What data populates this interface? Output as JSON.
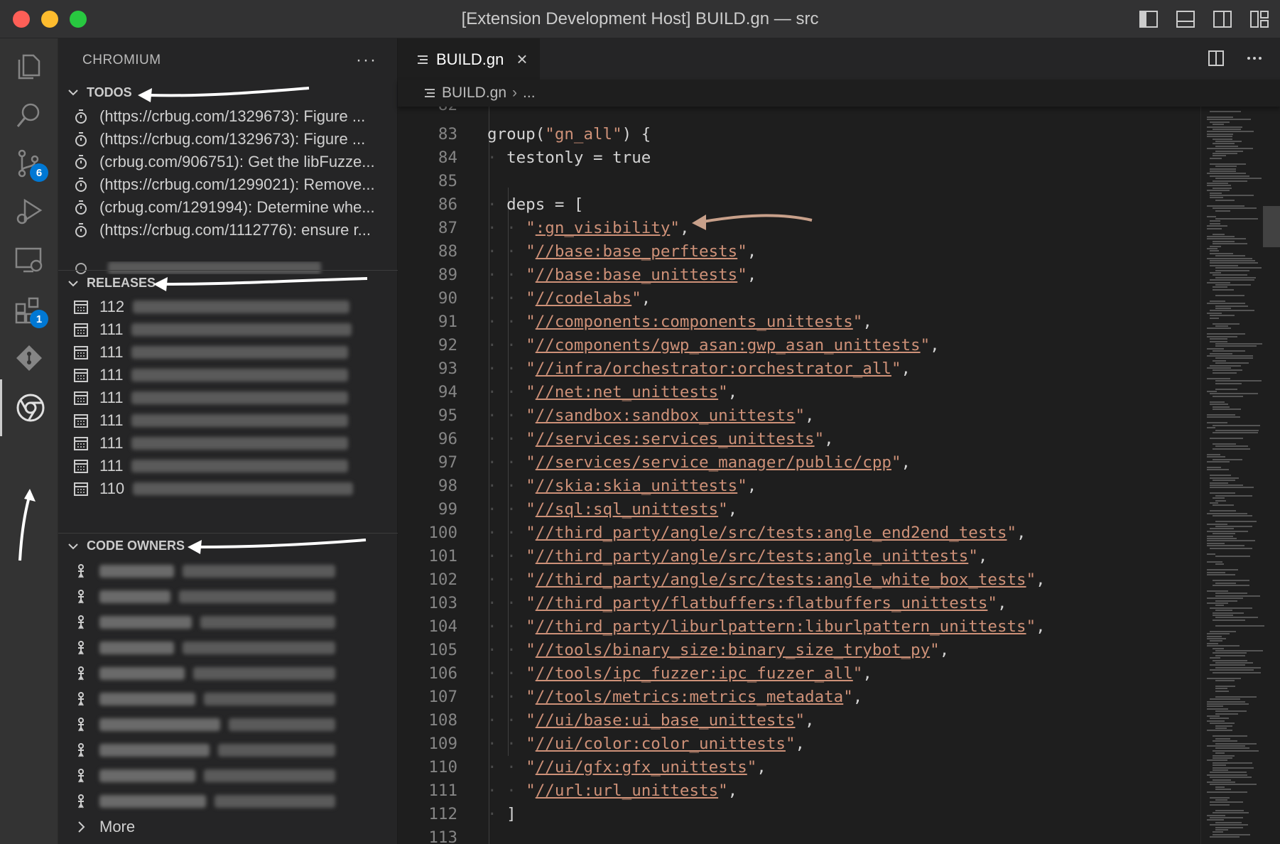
{
  "window": {
    "title": "[Extension Development Host] BUILD.gn — src"
  },
  "activity_bar": {
    "scm_badge": "6",
    "extensions_badge": "1"
  },
  "sidebar": {
    "title": "CHROMIUM",
    "more": "···",
    "todos": {
      "label": "TODOS",
      "items": [
        "(https://crbug.com/1329673): Figure ...",
        "(https://crbug.com/1329673): Figure ...",
        "(crbug.com/906751): Get the libFuzze...",
        "(https://crbug.com/1299021): Remove...",
        "(crbug.com/1291994): Determine whe...",
        "(https://crbug.com/1112776): ensure r..."
      ]
    },
    "releases": {
      "label": "RELEASES",
      "items": [
        "112",
        "111",
        "111",
        "111",
        "111",
        "111",
        "111",
        "111",
        "110"
      ]
    },
    "code_owners": {
      "label": "CODE OWNERS",
      "count": 10,
      "more_label": "More"
    }
  },
  "editor": {
    "tab_label": "BUILD.gn",
    "breadcrumb_file": "BUILD.gn",
    "breadcrumb_rest": "...",
    "lines": [
      {
        "n": "83",
        "kind": "plain",
        "indent": 0,
        "text": "group(",
        "str": "\"gn_all\"",
        "tail": ") {"
      },
      {
        "n": "84",
        "kind": "kw",
        "indent": 1,
        "text": "testonly = true"
      },
      {
        "n": "85",
        "kind": "blank",
        "indent": 0,
        "text": ""
      },
      {
        "n": "86",
        "kind": "kw",
        "indent": 1,
        "text": "deps = ["
      },
      {
        "n": "87",
        "kind": "dep",
        "indent": 2,
        "value": ":gn_visibility"
      },
      {
        "n": "88",
        "kind": "dep",
        "indent": 2,
        "value": "//base:base_perftests"
      },
      {
        "n": "89",
        "kind": "dep",
        "indent": 2,
        "value": "//base:base_unittests"
      },
      {
        "n": "90",
        "kind": "dep",
        "indent": 2,
        "value": "//codelabs"
      },
      {
        "n": "91",
        "kind": "dep",
        "indent": 2,
        "value": "//components:components_unittests"
      },
      {
        "n": "92",
        "kind": "dep",
        "indent": 2,
        "value": "//components/gwp_asan:gwp_asan_unittests"
      },
      {
        "n": "93",
        "kind": "dep",
        "indent": 2,
        "value": "//infra/orchestrator:orchestrator_all"
      },
      {
        "n": "94",
        "kind": "dep",
        "indent": 2,
        "value": "//net:net_unittests"
      },
      {
        "n": "95",
        "kind": "dep",
        "indent": 2,
        "value": "//sandbox:sandbox_unittests"
      },
      {
        "n": "96",
        "kind": "dep",
        "indent": 2,
        "value": "//services:services_unittests"
      },
      {
        "n": "97",
        "kind": "dep",
        "indent": 2,
        "value": "//services/service_manager/public/cpp"
      },
      {
        "n": "98",
        "kind": "dep",
        "indent": 2,
        "value": "//skia:skia_unittests"
      },
      {
        "n": "99",
        "kind": "dep",
        "indent": 2,
        "value": "//sql:sql_unittests"
      },
      {
        "n": "100",
        "kind": "dep",
        "indent": 2,
        "value": "//third_party/angle/src/tests:angle_end2end_tests"
      },
      {
        "n": "101",
        "kind": "dep",
        "indent": 2,
        "value": "//third_party/angle/src/tests:angle_unittests"
      },
      {
        "n": "102",
        "kind": "dep",
        "indent": 2,
        "value": "//third_party/angle/src/tests:angle_white_box_tests"
      },
      {
        "n": "103",
        "kind": "dep",
        "indent": 2,
        "value": "//third_party/flatbuffers:flatbuffers_unittests"
      },
      {
        "n": "104",
        "kind": "dep",
        "indent": 2,
        "value": "//third_party/liburlpattern:liburlpattern_unittests"
      },
      {
        "n": "105",
        "kind": "dep",
        "indent": 2,
        "value": "//tools/binary_size:binary_size_trybot_py"
      },
      {
        "n": "106",
        "kind": "dep",
        "indent": 2,
        "value": "//tools/ipc_fuzzer:ipc_fuzzer_all"
      },
      {
        "n": "107",
        "kind": "dep",
        "indent": 2,
        "value": "//tools/metrics:metrics_metadata"
      },
      {
        "n": "108",
        "kind": "dep",
        "indent": 2,
        "value": "//ui/base:ui_base_unittests"
      },
      {
        "n": "109",
        "kind": "dep",
        "indent": 2,
        "value": "//ui/color:color_unittests"
      },
      {
        "n": "110",
        "kind": "dep",
        "indent": 2,
        "value": "//ui/gfx:gfx_unittests"
      },
      {
        "n": "111",
        "kind": "dep",
        "indent": 2,
        "value": "//url:url_unittests"
      },
      {
        "n": "112",
        "kind": "kw",
        "indent": 1,
        "text": "]"
      },
      {
        "n": "113",
        "kind": "blank",
        "indent": 0,
        "text": ""
      }
    ]
  },
  "colors": {
    "string": "#ce9178",
    "line_number": "#858585",
    "badge": "#0078d4",
    "annotation_arrow_editor": "#c8a08a"
  }
}
